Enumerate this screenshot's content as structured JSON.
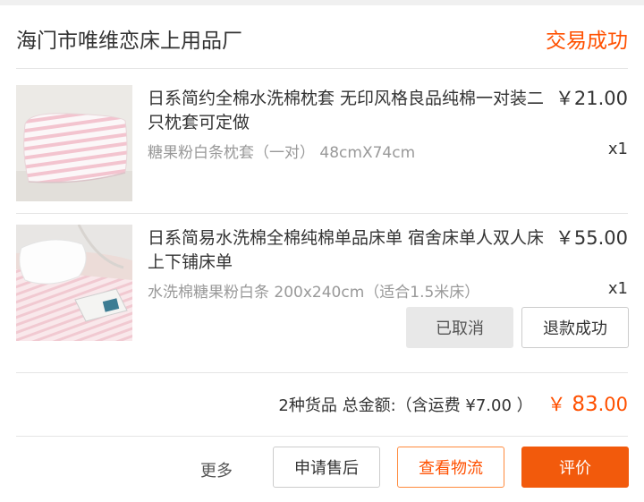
{
  "store": {
    "name": "海门市唯维恋床上用品厂",
    "status": "交易成功"
  },
  "items": [
    {
      "title": "日系简约全棉水洗棉枕套 无印风格良品纯棉一对装二只枕套可定做",
      "price": "￥21.00",
      "sku": "糖果粉白条枕套（一对） 48cmX74cm",
      "qty": "x1",
      "image_icon": "pillowcase-photo"
    },
    {
      "title": "日系简易水洗棉全棉纯棉单品床单 宿舍床单人双人床上下铺床单",
      "price": "￥55.00",
      "sku": "水洗棉糖果粉白条 200x240cm（适合1.5米床）",
      "qty": "x1",
      "image_icon": "bedsheet-photo",
      "actions": {
        "cancelled": "已取消",
        "refund": "退款成功"
      }
    }
  ],
  "summary": {
    "text": "2种货品 总金额:（含运费 ¥7.00 ）",
    "total_symbol": "￥",
    "total_int": "83",
    "total_dec": ".00"
  },
  "footer": {
    "more": "更多",
    "after_sale": "申请售后",
    "logistics": "查看物流",
    "review": "评价"
  },
  "colors": {
    "accent": "#ff5000",
    "button_fill": "#f25a0c"
  }
}
